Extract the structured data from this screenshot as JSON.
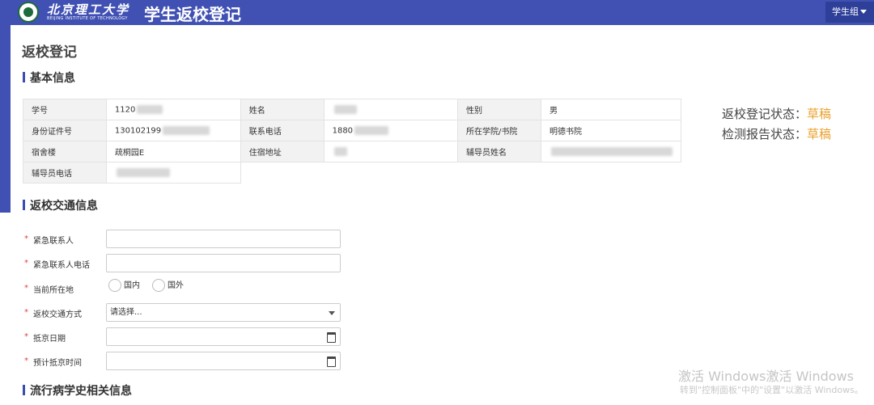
{
  "header": {
    "logo_cn": "北京理工大学",
    "logo_en": "BEIJING INSTITUTE OF TECHNOLOGY",
    "app_title": "学生返校登记",
    "user_menu": "学生组"
  },
  "page_title": "返校登记",
  "sections": {
    "basic": "基本信息",
    "transport": "返校交通信息",
    "epidemic": "流行病学史相关信息"
  },
  "basic_info": {
    "student_id_label": "学号",
    "student_id_value": "1120",
    "name_label": "姓名",
    "gender_label": "性别",
    "gender_value": "男",
    "id_card_label": "身份证件号",
    "id_card_value": "130102199",
    "phone_label": "联系电话",
    "phone_value": "1880",
    "college_label": "所在学院/书院",
    "college_value": "明德书院",
    "dorm_label": "宿舍楼",
    "dorm_value": "疏桐园E",
    "address_label": "住宿地址",
    "counselor_label": "辅导员姓名",
    "counselor_phone_label": "辅导员电话"
  },
  "status": {
    "register_label": "返校登记状态：",
    "register_value": "草稿",
    "report_label": "检测报告状态：",
    "report_value": "草稿"
  },
  "form": {
    "required_mark": "*",
    "emergency_contact_label": "紧急联系人",
    "emergency_phone_label": "紧急联系人电话",
    "location_label": "当前所在地",
    "location_options": [
      "国内",
      "国外"
    ],
    "transport_label": "返校交通方式",
    "transport_placeholder": "请选择...",
    "arrival_date_label": "抵京日期",
    "planned_time_label": "预计抵京时间"
  },
  "watermark": {
    "line1": "激活 Windows激活 Windows",
    "line2": "转到\"控制面板\"中的\"设置\"以激活 Windows。"
  }
}
